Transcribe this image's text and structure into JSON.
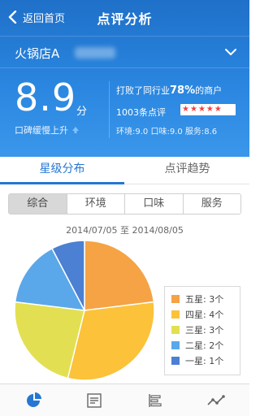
{
  "nav": {
    "back_label": "返回首页",
    "title": "点评分析"
  },
  "store": {
    "name": "火锅店A"
  },
  "summary": {
    "score": "8.9",
    "score_unit": "分",
    "trend_text": "口碑缓慢上升",
    "beat_prefix": "打败了同行业",
    "beat_percent": "78%",
    "beat_suffix": "的商户",
    "review_count": "1003条点评",
    "star_rating": 5,
    "sub_scores": "环境:9.0  口味:9.0  服务:8.6"
  },
  "tabs": [
    {
      "label": "星级分布",
      "active": true
    },
    {
      "label": "点评趋势",
      "active": false
    }
  ],
  "segments": [
    {
      "label": "综合",
      "active": true
    },
    {
      "label": "环境",
      "active": false
    },
    {
      "label": "口味",
      "active": false
    },
    {
      "label": "服务",
      "active": false
    }
  ],
  "date_range": "2014/07/05 至 2014/08/05",
  "chart_data": {
    "type": "pie",
    "legend_position": "right",
    "slices": [
      {
        "label": "五星",
        "value": 3,
        "display": "3个",
        "color": "#f5a345"
      },
      {
        "label": "四星",
        "value": 4,
        "display": "4个",
        "color": "#fbc23a"
      },
      {
        "label": "三星",
        "value": 3,
        "display": "3个",
        "color": "#e2e052"
      },
      {
        "label": "二星",
        "value": 2,
        "display": "2个",
        "color": "#5aa8ea"
      },
      {
        "label": "一星",
        "value": 1,
        "display": "1个",
        "color": "#4b80d2"
      }
    ]
  },
  "bottom_nav": [
    {
      "icon": "pie-chart-icon",
      "active": true
    },
    {
      "icon": "review-list-icon",
      "active": false
    },
    {
      "icon": "bar-list-icon",
      "active": false
    },
    {
      "icon": "trend-line-icon",
      "active": false
    }
  ],
  "colors": {
    "primary": "#2577d4",
    "hero_top": "#1f70c8",
    "hero_bottom": "#3a97ea",
    "star_red": "#ee4444"
  }
}
